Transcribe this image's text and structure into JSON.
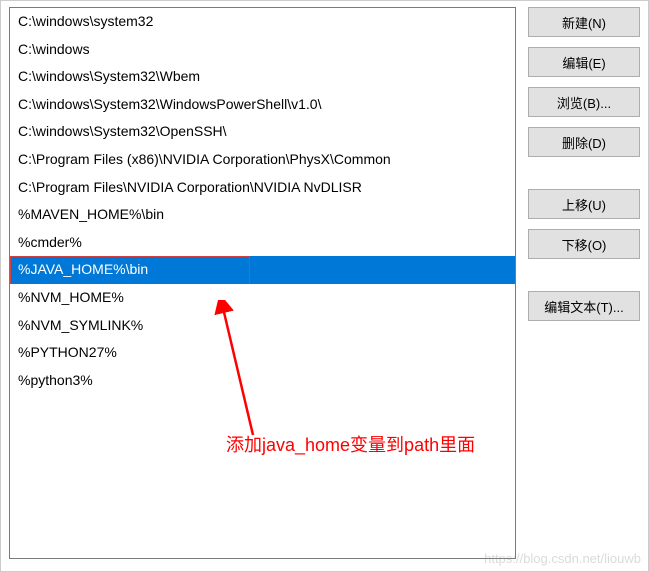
{
  "list": {
    "items": [
      {
        "text": "C:\\windows\\system32",
        "selected": false
      },
      {
        "text": "C:\\windows",
        "selected": false
      },
      {
        "text": "C:\\windows\\System32\\Wbem",
        "selected": false
      },
      {
        "text": "C:\\windows\\System32\\WindowsPowerShell\\v1.0\\",
        "selected": false
      },
      {
        "text": "C:\\windows\\System32\\OpenSSH\\",
        "selected": false
      },
      {
        "text": "C:\\Program Files (x86)\\NVIDIA Corporation\\PhysX\\Common",
        "selected": false
      },
      {
        "text": "C:\\Program Files\\NVIDIA Corporation\\NVIDIA NvDLISR",
        "selected": false
      },
      {
        "text": "%MAVEN_HOME%\\bin",
        "selected": false
      },
      {
        "text": "%cmder%",
        "selected": false
      },
      {
        "text": "%JAVA_HOME%\\bin",
        "selected": true
      },
      {
        "text": "%NVM_HOME%",
        "selected": false
      },
      {
        "text": "%NVM_SYMLINK%",
        "selected": false
      },
      {
        "text": "%PYTHON27%",
        "selected": false
      },
      {
        "text": "%python3%",
        "selected": false
      }
    ]
  },
  "buttons": {
    "new": "新建(N)",
    "edit": "编辑(E)",
    "browse": "浏览(B)...",
    "delete": "删除(D)",
    "moveup": "上移(U)",
    "movedown": "下移(O)",
    "edittext": "编辑文本(T)..."
  },
  "annotation": "添加java_home变量到path里面",
  "watermark": "https://blog.csdn.net/liouwb"
}
